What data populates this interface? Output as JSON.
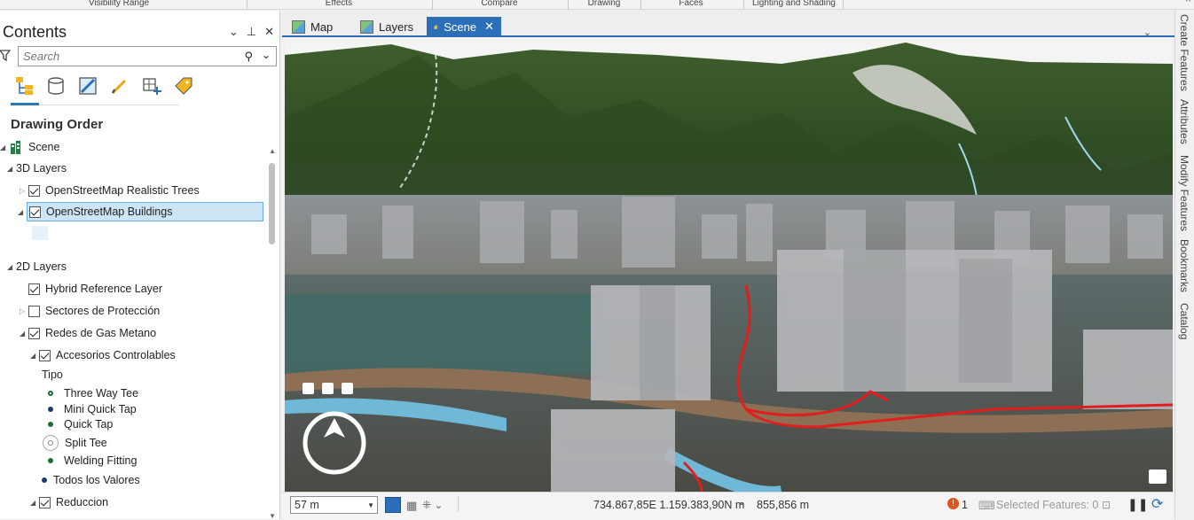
{
  "ribbon": {
    "groups": [
      "Visibility Range",
      "Effects",
      "Compare",
      "Drawing",
      "Faces",
      "Lighting and Shading"
    ]
  },
  "contents": {
    "title": "Contents",
    "search_placeholder": "Search",
    "section_title": "Drawing Order",
    "tree": {
      "scene": "Scene",
      "layers3d": "3D Layers",
      "realistic_trees": "OpenStreetMap Realistic Trees",
      "buildings": "OpenStreetMap Buildings",
      "layers2d": "2D Layers",
      "hybrid_ref": "Hybrid Reference Layer",
      "sectores": "Sectores de Protección",
      "redes_gas": "Redes de Gas Metano",
      "accesorios": "Accesorios Controlables",
      "tipo": "Tipo",
      "three_way_tee": "Three Way Tee",
      "mini_quick_tap": "Mini Quick Tap",
      "quick_tap": "Quick Tap",
      "split_tee": "Split Tee",
      "welding_fitting": "Welding Fitting",
      "todos_valores": "Todos los Valores",
      "reduccion": "Reduccion"
    }
  },
  "tabs": {
    "map": "Map",
    "layers": "Layers",
    "scene": "Scene"
  },
  "status": {
    "scale": "57 m",
    "coords": "734.867,85E 1.159.383,90N m",
    "elevation": "855,856 m",
    "notifications": "1",
    "selected_features": "Selected Features: 0"
  },
  "side_dock": [
    "Create Features",
    "Attributes",
    "Modify Features",
    "Bookmarks",
    "Catalog"
  ],
  "colors": {
    "accent": "#2a6fb8",
    "selection": "#cde4f5",
    "symbol_green": "#1f6e3a",
    "symbol_navy": "#1c3a6e",
    "pipe_red": "#e21d1d",
    "error_orange": "#e0531a"
  }
}
